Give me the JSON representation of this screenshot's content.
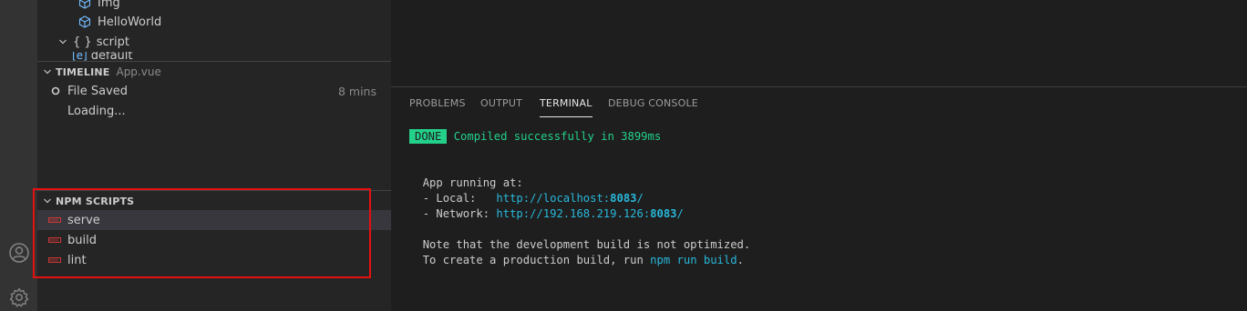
{
  "explorer": {
    "items": [
      {
        "label": "Img",
        "icon": "cube-icon"
      },
      {
        "label": "HelloWorld",
        "icon": "cube-icon"
      },
      {
        "label": "script",
        "prefix": "{ }"
      },
      {
        "label": "default",
        "prefix": "[e]"
      }
    ]
  },
  "timeline": {
    "title": "TIMELINE",
    "file": "App.vue",
    "entries": [
      {
        "label": "File Saved",
        "time": "8 mins"
      }
    ],
    "loading": "Loading..."
  },
  "npm_scripts": {
    "title": "NPM SCRIPTS",
    "items": [
      {
        "label": "serve"
      },
      {
        "label": "build"
      },
      {
        "label": "lint"
      }
    ]
  },
  "panel": {
    "tabs": [
      {
        "label": "PROBLEMS"
      },
      {
        "label": "OUTPUT"
      },
      {
        "label": "TERMINAL"
      },
      {
        "label": "DEBUG CONSOLE"
      }
    ],
    "active_tab": "TERMINAL"
  },
  "terminal": {
    "badge": "DONE",
    "compiled": "Compiled successfully in 3899ms",
    "running": "App running at:",
    "local_label": "- Local:   ",
    "local_url_a": "http://localhost:",
    "local_port": "8083",
    "local_url_b": "/",
    "network_label": "- Network: ",
    "network_url_a": "http://192.168.219.126:",
    "network_port": "8083",
    "network_url_b": "/",
    "note1": "Note that the development build is not optimized.",
    "note2_a": "To create a production build, run ",
    "note2_cmd": "npm run build",
    "note2_b": "."
  },
  "colors": {
    "highlight_box": "#e51010",
    "done_badge": "#23d18b",
    "link": "#29b8db"
  }
}
